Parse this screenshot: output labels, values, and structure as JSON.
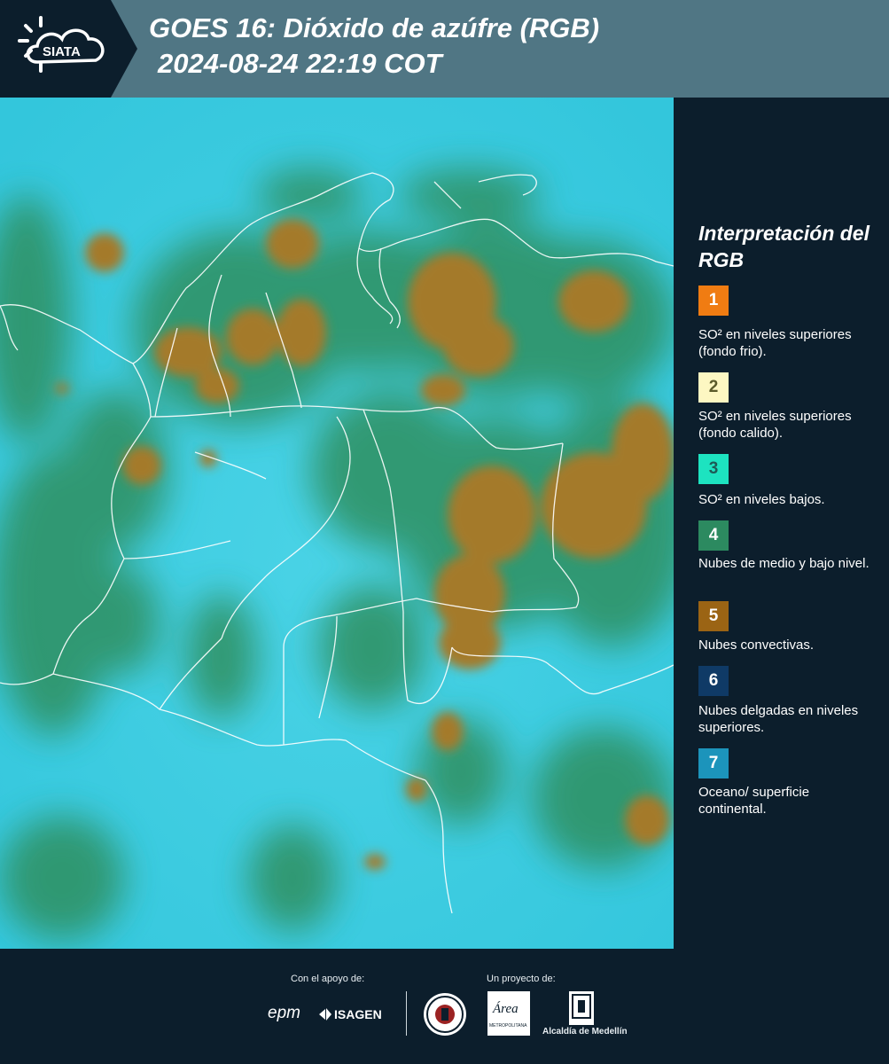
{
  "header": {
    "logo_text": "SIATA",
    "title_line1": "GOES 16: Dióxido de azúfre (RGB)",
    "title_line2": "2024-08-24 22:19 COT",
    "bg_color": "#507684"
  },
  "legend": {
    "title": "Interpretación del RGB",
    "items": [
      {
        "num": "1",
        "color": "#f07c12",
        "numColor": "#ffffff",
        "text": "SO² en niveles superiores (fondo frio)."
      },
      {
        "num": "2",
        "color": "#fdf7c2",
        "numColor": "#5a5a2a",
        "text": "SO² en niveles superiores (fondo calido)."
      },
      {
        "num": "3",
        "color": "#1de3c0",
        "numColor": "#1e5a55",
        "text": "SO² en niveles bajos."
      },
      {
        "num": "4",
        "color": "#2c8a60",
        "numColor": "#ffffff",
        "text": "Nubes de medio y bajo nivel."
      },
      {
        "num": "5",
        "color": "#9b6414",
        "numColor": "#ffffff",
        "text": "Nubes convectivas."
      },
      {
        "num": "6",
        "color": "#0f3a66",
        "numColor": "#ffffff",
        "text": "Nubes delgadas en niveles superiores."
      },
      {
        "num": "7",
        "color": "#1c94bb",
        "numColor": "#ffffff",
        "text": "Oceano/ superficie continental."
      }
    ]
  },
  "footer": {
    "support_label": "Con el apoyo de:",
    "project_label": "Un proyecto de:",
    "sponsor1": "epm",
    "sponsor2": "ISAGEN",
    "partner1": "Área Metropolitana Valle de Aburrá",
    "partner1_mark": "Área",
    "partner1_sub": "METROPOLITANA",
    "partner2": "Alcaldía de Medellín"
  },
  "map": {
    "background_color": "#3ccbe0",
    "cloud_color": "#a47a2c",
    "midcloud_color": "#2e9060"
  }
}
